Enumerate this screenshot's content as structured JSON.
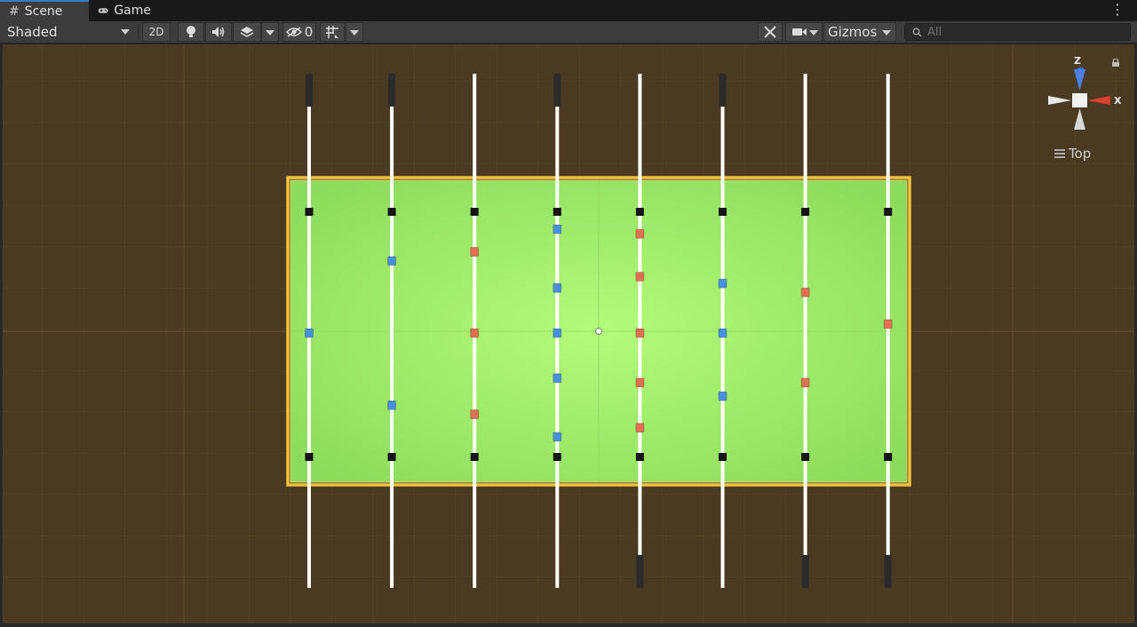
{
  "tabs": [
    {
      "label": "Scene",
      "icon": "grid-hash-icon",
      "active": true
    },
    {
      "label": "Game",
      "icon": "gamepad-icon",
      "active": false
    }
  ],
  "toolbar": {
    "shading_mode": "Shaded",
    "two_d_label": "2D",
    "hidden_count": "0",
    "gizmos_label": "Gizmos",
    "search_placeholder": "All"
  },
  "orientation_gizmo": {
    "z_label": "Z",
    "x_label": "X",
    "view_label": "Top"
  },
  "colors": {
    "background_grid": "#4a3a20",
    "field": "#9fe870",
    "field_border": "#f0c040",
    "team_blue": "#4a90e0",
    "team_red": "#e07050",
    "rod": "#ffffff",
    "handle": "#2b2b2b"
  },
  "table": {
    "rods": [
      {
        "team": "blue",
        "handles": "top",
        "players": [
          0.5
        ]
      },
      {
        "team": "blue",
        "handles": "top",
        "players": [
          0.18,
          0.82
        ]
      },
      {
        "team": "red",
        "handles": "none",
        "players": [
          0.14,
          0.5,
          0.86
        ]
      },
      {
        "team": "blue",
        "handles": "top",
        "players": [
          0.04,
          0.3,
          0.5,
          0.7,
          0.96
        ]
      },
      {
        "team": "red",
        "handles": "bottom",
        "players": [
          0.06,
          0.25,
          0.5,
          0.72,
          0.92
        ]
      },
      {
        "team": "blue",
        "handles": "top",
        "players": [
          0.28,
          0.5,
          0.78
        ]
      },
      {
        "team": "red",
        "handles": "bottom",
        "players": [
          0.32,
          0.72
        ]
      },
      {
        "team": "red",
        "handles": "bottom",
        "players": [
          0.46
        ]
      }
    ]
  }
}
